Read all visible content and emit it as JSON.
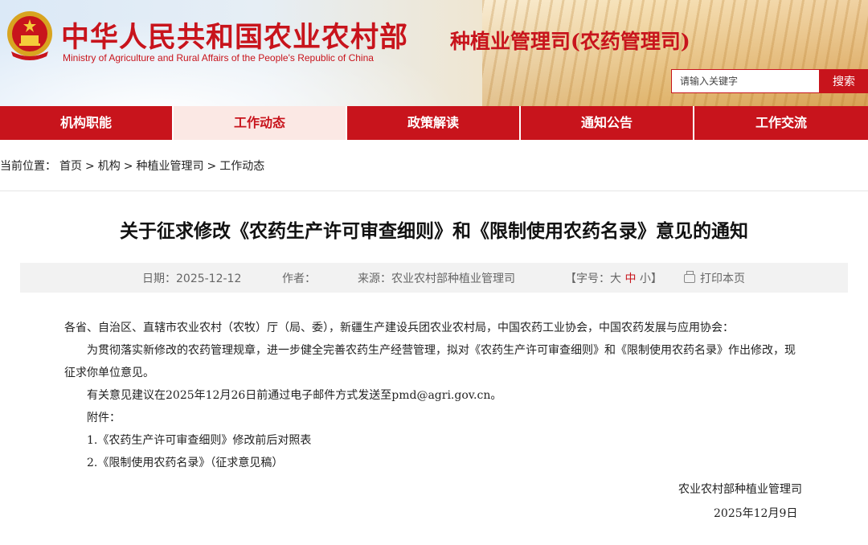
{
  "header": {
    "site_name_cn": "中华人民共和国农业农村部",
    "site_name_en": "Ministry of Agriculture and Rural Affairs of the People's Republic of China",
    "department": "种植业管理司(农药管理司)",
    "search": {
      "placeholder": "请输入关键字",
      "button_label": "搜索"
    }
  },
  "nav": {
    "items": [
      {
        "label": "机构职能"
      },
      {
        "label": "工作动态",
        "active": true
      },
      {
        "label": "政策解读"
      },
      {
        "label": "通知公告"
      },
      {
        "label": "工作交流"
      }
    ]
  },
  "breadcrumb": {
    "prefix": "当前位置：",
    "items": [
      "首页",
      "机构",
      "种植业管理司",
      "工作动态"
    ],
    "separator": ">"
  },
  "article": {
    "title": "关于征求修改《农药生产许可审查细则》和《限制使用农药名录》意见的通知",
    "meta": {
      "date_label": "日期：",
      "date": "2025-12-12",
      "author_label": "作者：",
      "author": "",
      "source_label": "来源：",
      "source": "农业农村部种植业管理司",
      "fontsize_label": "【字号：",
      "size_large": "大",
      "size_medium": "中",
      "size_small": "小",
      "fontsize_end": "】",
      "print_label": "打印本页"
    },
    "salutation": "各省、自治区、直辖市农业农村（农牧）厅（局、委），新疆生产建设兵团农业农村局，中国农药工业协会，中国农药发展与应用协会：",
    "paragraph1": "为贯彻落实新修改的农药管理规章，进一步健全完善农药生产经营管理，拟对《农药生产许可审查细则》和《限制使用农药名录》作出修改，现征求你单位意见。",
    "paragraph2": "有关意见建议在2025年12月26日前通过电子邮件方式发送至pmd@agri.gov.cn。",
    "attachments_label": "附件：",
    "attachments": [
      "1.《农药生产许可审查细则》修改前后对照表",
      "2.《限制使用农药名录》（征求意见稿）"
    ],
    "signature": "农业农村部种植业管理司",
    "sign_date": "2025年12月9日"
  },
  "colors": {
    "brand_red": "#c8141c",
    "nav_active_bg": "#fbe8e4",
    "meta_bg": "#f2f2f2"
  }
}
